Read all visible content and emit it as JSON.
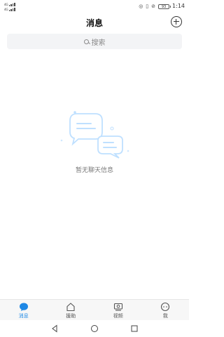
{
  "status_bar": {
    "sig1_label": "4G",
    "sig2_label": "4G",
    "wifi_label": "",
    "battery": "93",
    "time": "1:14"
  },
  "header": {
    "title": "消息"
  },
  "search": {
    "placeholder": "搜索"
  },
  "empty_state": {
    "message": "暂无聊天信息"
  },
  "bottom_nav": {
    "items": [
      {
        "label": "消息",
        "icon": "chat-bubble-icon",
        "active": true
      },
      {
        "label": "援助",
        "icon": "home-icon",
        "active": false
      },
      {
        "label": "视频",
        "icon": "video-icon",
        "active": false
      },
      {
        "label": "我",
        "icon": "profile-icon",
        "active": false
      }
    ]
  },
  "colors": {
    "accent": "#1e88e5",
    "illustration": "#bfe0ff",
    "search_bg": "#f3f4f6"
  }
}
